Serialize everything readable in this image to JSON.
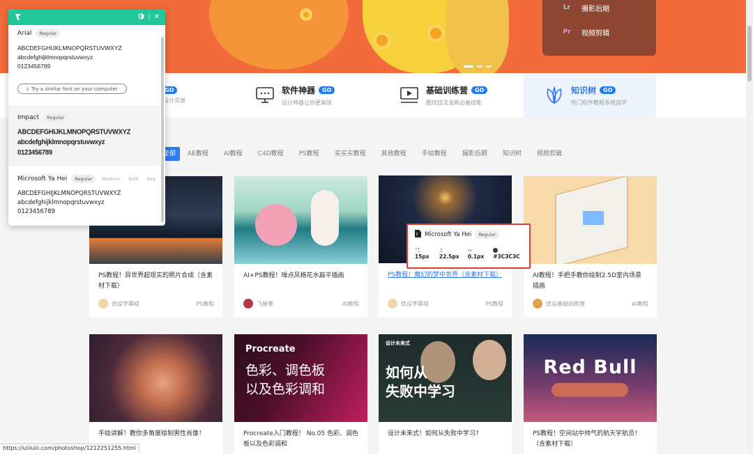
{
  "hero_panel": {
    "items": [
      {
        "badge": "Lr",
        "label": "摄影后期",
        "color": "#a5c9e0"
      },
      {
        "badge": "Pr",
        "label": "视频剪辑",
        "color": "#c89ff0"
      }
    ]
  },
  "nav": {
    "items": [
      {
        "title": "",
        "sub": "你设计灵感",
        "go": "GO"
      },
      {
        "title": "软件神器",
        "sub": "设计神器让你更高效",
        "go": "GO"
      },
      {
        "title": "基础训练营",
        "sub": "酷炫技法涨新必备技能",
        "go": "GO"
      },
      {
        "title": "知识树",
        "sub": "热门软件教程系统自学",
        "go": "GO"
      }
    ]
  },
  "filters": [
    "全部",
    "AE教程",
    "AI教程",
    "C4D教程",
    "PS教程",
    "买买买教程",
    "其他教程",
    "手绘教程",
    "摄影后期",
    "知识树",
    "视频剪辑"
  ],
  "cards_row1": [
    {
      "title": "PS教程！异世界超现实的照片合成（含素材下载）",
      "author": "优设字幕组",
      "category": "PS教程"
    },
    {
      "title": "AI+PS教程！噪点风格花水扁平插画",
      "author": "飞屋睿",
      "category": "AI教程"
    },
    {
      "title": "PS教程！魔幻的梦中世界（含素材下载）",
      "author": "优设字幕组",
      "category": "PS教程"
    },
    {
      "title": "AI教程！手把手教你绘制2.5D室内场景插画",
      "author": "优设基础训练营",
      "category": "AI教程"
    }
  ],
  "cards_row2": [
    {
      "title": "手绘讲解！教你多角度绘制男性肖像！",
      "overlay": ""
    },
    {
      "title": "Procreate入门教程！ No.05 色彩、调色板以及色彩调和",
      "overlay": "Procreate",
      "overlay2": "色彩、调色板",
      "overlay3": "以及色彩调和"
    },
    {
      "title": "设计未来式！如何从失败中学习?",
      "overlay": "设计未来式",
      "overlay2": "如何从",
      "overlay3": "失败中学习"
    },
    {
      "title": "PS教程！空间站中帅气的航天宇航员！（含素材下载）",
      "overlay": "Red Bull"
    }
  ],
  "font_popup": {
    "accent": "#20c79a",
    "fonts": [
      {
        "name": "Arial",
        "styles": [
          "Regular"
        ],
        "upper": "ABCDEFGHIJKLMNOPQRSTUVWXYZ",
        "lower": "abcdefghijklmnopqrstuvwxyz",
        "digits": "0123456789"
      },
      {
        "name": "Impact",
        "styles": [
          "Regular"
        ],
        "upper": "ABCDEFGHIJKLMNOPQRSTUVWXYZ",
        "lower": "abcdefghijklmnopqrstuvwxyz",
        "digits": "0123456789"
      },
      {
        "name": "Microsoft Ya Hei",
        "styles": [
          "Regular",
          "Medium",
          "Bold",
          "Reg"
        ],
        "upper": "ABCDEFGHIJKLMNOPQRSTUVWXYZ",
        "lower": "abcdefghijklmnopqrstuvwxyz",
        "digits": "0123456789"
      }
    ],
    "search_label": "Try a similar font on your computer"
  },
  "tooltip": {
    "font": "Microsoft Ya Hei",
    "style": "Regular",
    "size": "15px",
    "line_height": "22.5px",
    "letter_spacing": "0.1px",
    "color": "#3C3C3C"
  },
  "status_url": "https://uiiiuiii.com/photoshop/1212251255.html"
}
